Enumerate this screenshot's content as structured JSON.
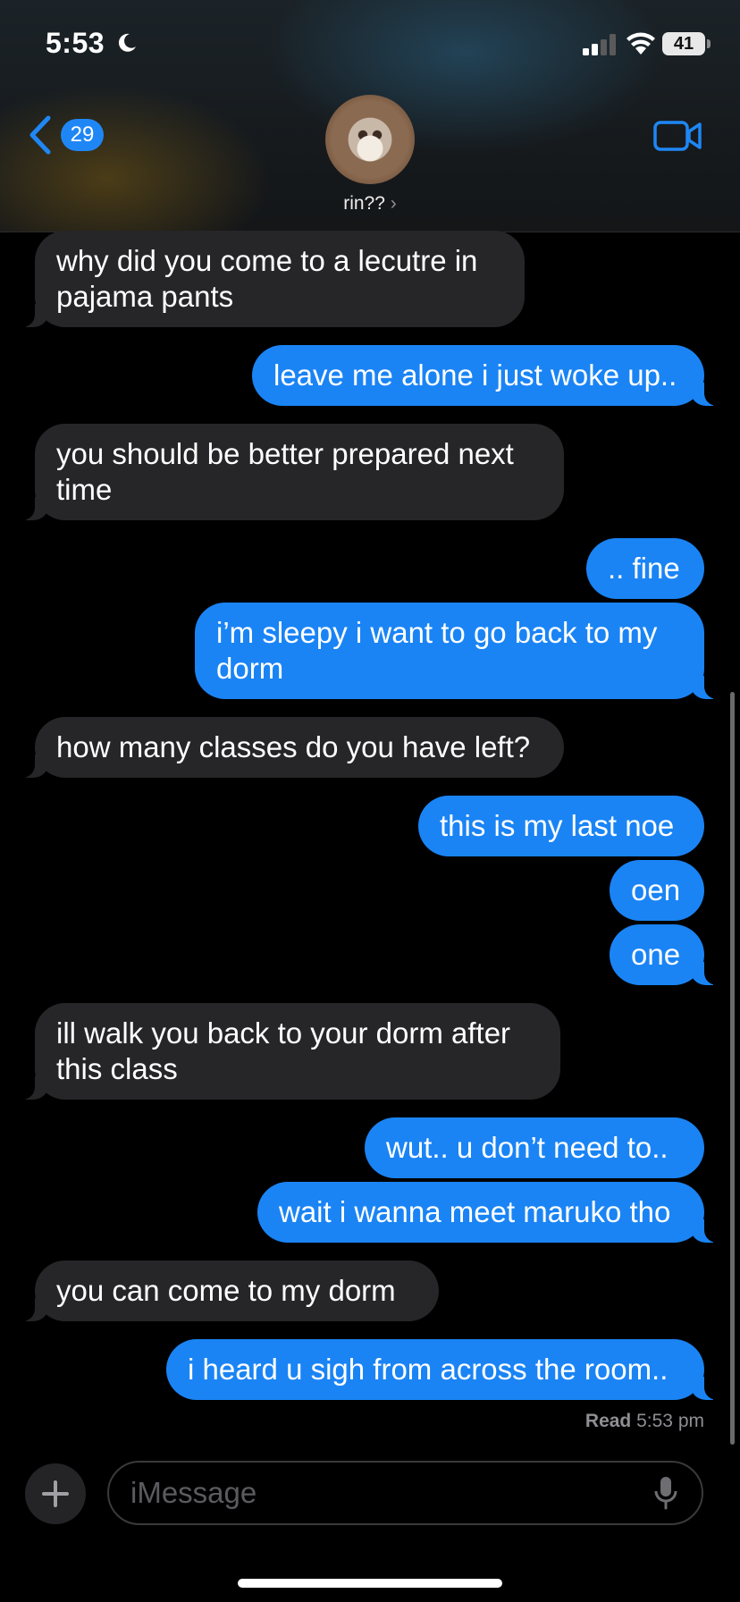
{
  "status_bar": {
    "time": "5:53",
    "battery": "41"
  },
  "header": {
    "back_count": "29",
    "contact_name": "rin??"
  },
  "messages": [
    {
      "side": "in",
      "text": "why did you come to a lecutre in pajama pants"
    },
    {
      "side": "out",
      "text": "leave me alone i just woke up.."
    },
    {
      "side": "in",
      "text": "you should be better prepared next time"
    },
    {
      "side": "out",
      "text": ".. fine"
    },
    {
      "side": "out",
      "text": "i’m sleepy i want to go back to my dorm"
    },
    {
      "side": "in",
      "text": "how many classes do you have left?"
    },
    {
      "side": "out",
      "text": "this is my last noe"
    },
    {
      "side": "out",
      "text": "oen"
    },
    {
      "side": "out",
      "text": "one"
    },
    {
      "side": "in",
      "text": "ill walk you back to your dorm after this class"
    },
    {
      "side": "out",
      "text": "wut.. u don’t need to.."
    },
    {
      "side": "out",
      "text": "wait i wanna meet maruko tho"
    },
    {
      "side": "in",
      "text": "you can come to my dorm"
    },
    {
      "side": "out",
      "text": "i heard u sigh from across the room.."
    }
  ],
  "read_receipt": {
    "label": "Read",
    "time": "5:53 pm"
  },
  "composer": {
    "placeholder": "iMessage"
  },
  "colors": {
    "outgoing": "#1a84f5",
    "incoming": "#262628",
    "accent": "#1f87f5"
  },
  "icons": [
    "moon-icon",
    "signal-icon",
    "wifi-icon",
    "battery-icon",
    "back-chevron-icon",
    "video-camera-icon",
    "plus-icon",
    "microphone-icon"
  ]
}
